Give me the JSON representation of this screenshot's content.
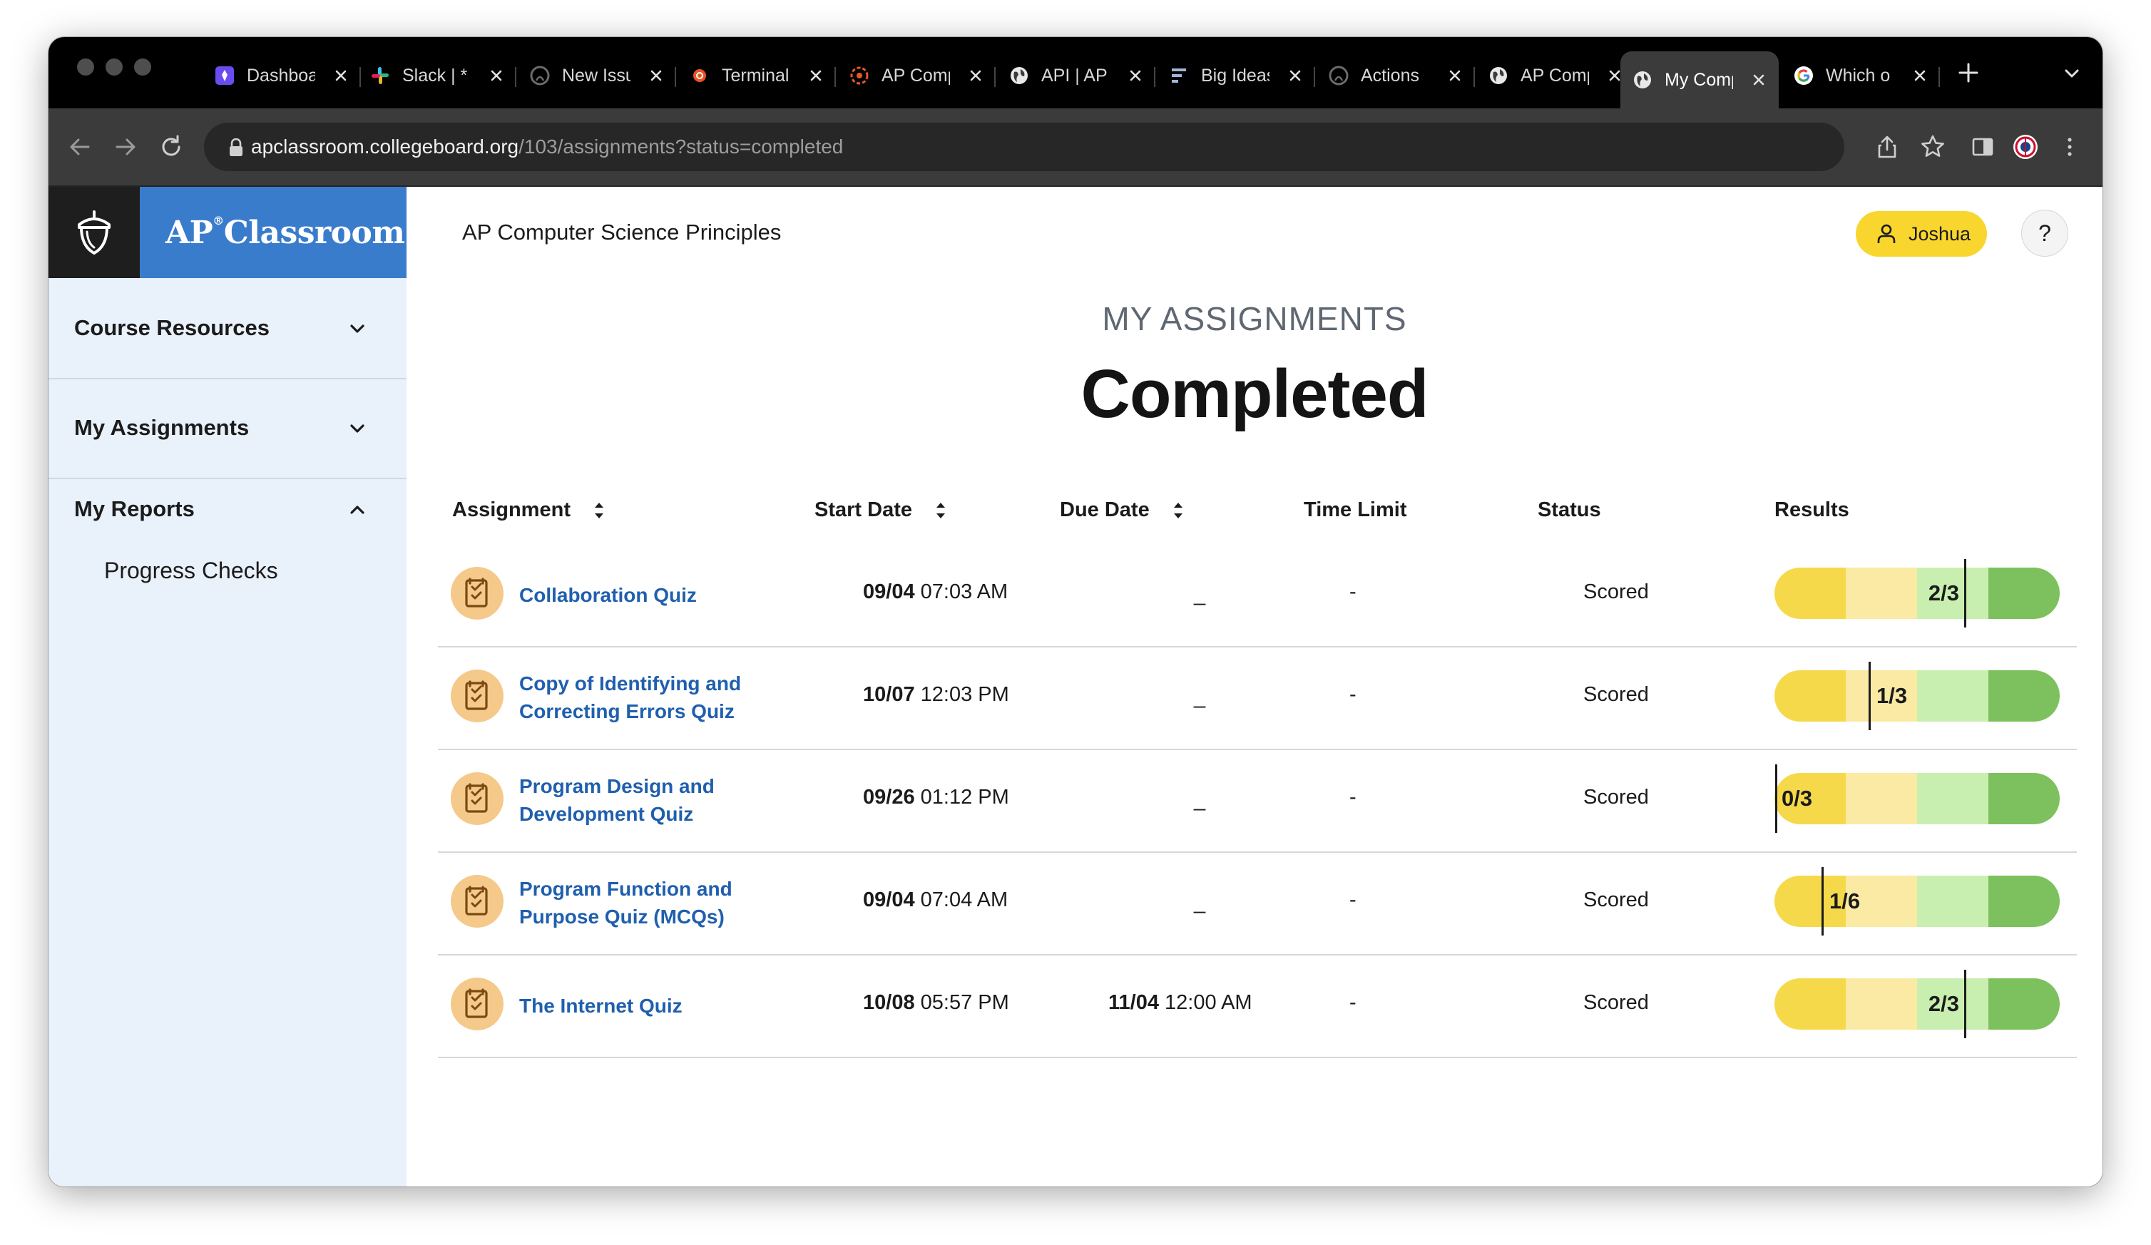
{
  "browser": {
    "tabs": [
      {
        "title": "Dashboard",
        "icon": "portal-icon",
        "active": false
      },
      {
        "title": "Slack | *",
        "icon": "slack-icon",
        "active": false
      },
      {
        "title": "New Issue",
        "icon": "github-icon",
        "active": false
      },
      {
        "title": "Terminal",
        "icon": "ubuntu-icon",
        "active": false
      },
      {
        "title": "AP Comp",
        "icon": "target-icon",
        "active": false
      },
      {
        "title": "API | AP",
        "icon": "globe-icon",
        "active": false
      },
      {
        "title": "Big Ideas",
        "icon": "diagram-icon",
        "active": false
      },
      {
        "title": "Actions",
        "icon": "github-icon",
        "active": false
      },
      {
        "title": "AP Comp",
        "icon": "globe-icon",
        "active": false
      },
      {
        "title": "My Comp",
        "icon": "globe-icon",
        "active": true
      },
      {
        "title": "Which o",
        "icon": "google-icon",
        "active": false
      }
    ],
    "url_host": "apclassroom.collegeboard.org",
    "url_path": "/103/assignments?status=completed"
  },
  "sidebar": {
    "logo_text": "AP",
    "logo_reg": "®",
    "logo_word": "Classroom",
    "sections": [
      {
        "label": "Course Resources",
        "expanded": false
      },
      {
        "label": "My Assignments",
        "expanded": false
      },
      {
        "label": "My Reports",
        "expanded": true
      }
    ],
    "report_items": [
      "Progress Checks"
    ]
  },
  "header": {
    "course_title": "AP Computer Science Principles",
    "user_name": "Joshua",
    "help_label": "?"
  },
  "main": {
    "kicker": "MY ASSIGNMENTS",
    "heading": "Completed",
    "columns": {
      "assignment": "Assignment",
      "start_date": "Start Date",
      "due_date": "Due Date",
      "time_limit": "Time Limit",
      "status": "Status",
      "results": "Results"
    },
    "rows": [
      {
        "name": "Collaboration Quiz",
        "start_day": "09/04",
        "start_time": "07:03 AM",
        "due_day": "",
        "due_time": "",
        "due_placeholder": "_",
        "time_limit": "-",
        "status": "Scored",
        "result": "2/3",
        "result_fraction": 0.667
      },
      {
        "name": "Copy of Identifying and Correcting Errors Quiz",
        "start_day": "10/07",
        "start_time": "12:03 PM",
        "due_day": "",
        "due_time": "",
        "due_placeholder": "_",
        "time_limit": "-",
        "status": "Scored",
        "result": "1/3",
        "result_fraction": 0.333
      },
      {
        "name": "Program Design and Development Quiz",
        "start_day": "09/26",
        "start_time": "01:12 PM",
        "due_day": "",
        "due_time": "",
        "due_placeholder": "_",
        "time_limit": "-",
        "status": "Scored",
        "result": "0/3",
        "result_fraction": 0.0
      },
      {
        "name": "Program Function and Purpose Quiz (MCQs)",
        "start_day": "09/04",
        "start_time": "07:04 AM",
        "due_day": "",
        "due_time": "",
        "due_placeholder": "_",
        "time_limit": "-",
        "status": "Scored",
        "result": "1/6",
        "result_fraction": 0.167
      },
      {
        "name": "The Internet Quiz",
        "start_day": "10/08",
        "start_time": "05:57 PM",
        "due_day": "11/04",
        "due_time": "12:00 AM",
        "due_placeholder": "",
        "time_limit": "-",
        "status": "Scored",
        "result": "2/3",
        "result_fraction": 0.667
      }
    ]
  },
  "colors": {
    "brand_blue": "#3a7ccc",
    "link_blue": "#1f5fae",
    "user_yellow": "#f8d62e",
    "band_1": "#f6d94a",
    "band_2": "#faeaa4",
    "band_3": "#c9efb0",
    "band_4": "#7cc15d"
  }
}
